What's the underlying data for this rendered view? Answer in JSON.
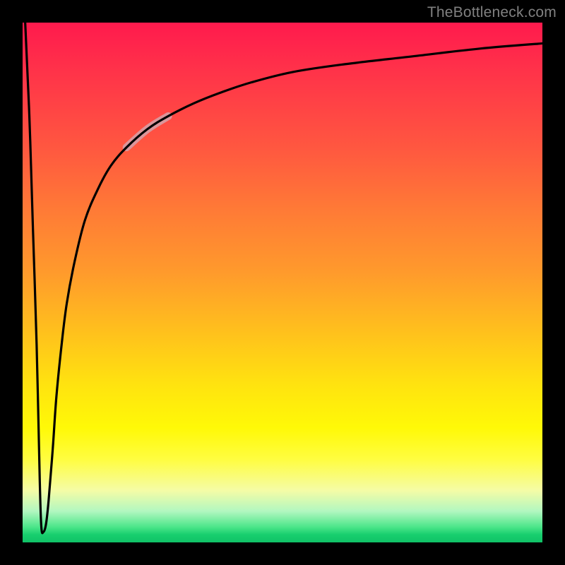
{
  "watermark": "TheBottleneck.com",
  "chart_data": {
    "type": "line",
    "title": "",
    "xlabel": "",
    "ylabel": "",
    "xlim": [
      0,
      100
    ],
    "ylim": [
      0,
      100
    ],
    "grid": false,
    "legend": false,
    "description": "Bottleneck percentage curve over a red-to-yellow-to-green vertical gradient background. Curve starts at top-left, plunges to a sharp minimum near x≈3 at y≈2, then rises logarithmically toward y≈96 as x→100. A short pale-pink highlight marks a segment of the curve.",
    "series": [
      {
        "name": "bottleneck-curve",
        "x": [
          0.5,
          1.3,
          2.0,
          2.7,
          3.3,
          3.6,
          4.0,
          4.5,
          5.0,
          5.8,
          6.5,
          7.5,
          8.5,
          10.0,
          12.0,
          14.5,
          17.0,
          20.0,
          24.0,
          28.0,
          33.0,
          38.0,
          44.0,
          52.0,
          62.0,
          75.0,
          88.0,
          100.0
        ],
        "y": [
          100.0,
          82.0,
          60.0,
          38.0,
          12.0,
          3.0,
          2.0,
          3.5,
          8.0,
          18.0,
          28.0,
          38.0,
          46.0,
          54.0,
          62.0,
          68.0,
          72.5,
          76.0,
          79.5,
          82.0,
          84.5,
          86.5,
          88.5,
          90.5,
          92.0,
          93.5,
          95.0,
          96.0
        ]
      }
    ],
    "highlight_segment": {
      "x_range": [
        20.5,
        28.5
      ],
      "y_range": [
        76.5,
        82.5
      ],
      "color": "#d89aa0",
      "stroke_width_px": 11
    },
    "colors": {
      "curve": "#000000",
      "frame": "#000000",
      "gradient_top": "#ff1a4d",
      "gradient_mid": "#fff907",
      "gradient_bottom": "#10c267",
      "watermark": "#808080"
    }
  }
}
